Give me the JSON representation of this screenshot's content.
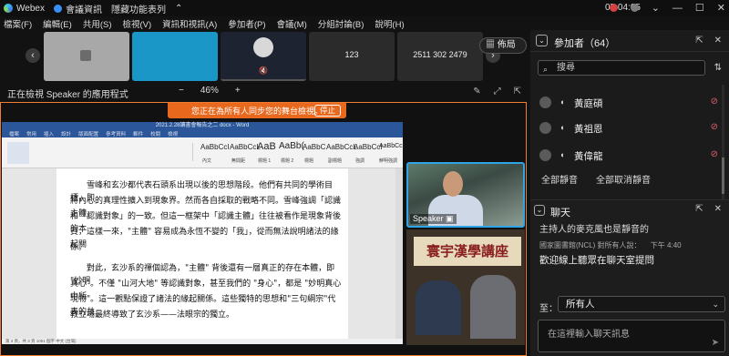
{
  "titlebar": {
    "app": "Webex",
    "meeting_info": "會議資訊",
    "hidden_list": "隱藏功能表列",
    "clock": "05:04:05"
  },
  "menu": [
    "檔案(F)",
    "編輯(E)",
    "共用(S)",
    "檢視(V)",
    "資訊和視訊(A)",
    "參加者(P)",
    "會議(M)",
    "分組討論(B)",
    "說明(H)"
  ],
  "strip": {
    "tile_a_label": "123",
    "tile_b_label": "2511 302 2479",
    "layout_button": "佈局"
  },
  "viewbar": {
    "viewing_text": "正在檢視 Speaker 的應用程式",
    "zoom_minus": "−",
    "zoom_value": "46%",
    "zoom_plus": "+"
  },
  "share": {
    "banner_text": "您正在為所有人同步您的舞台檢視。",
    "stop_label": "停止",
    "word_title": "2021.2.28讀書會報告之二 docx - Word",
    "word_tabs": [
      "檔案",
      "常用",
      "插入",
      "設計",
      "版面配置",
      "參考資料",
      "郵件",
      "校閱",
      "檢視"
    ],
    "styles": [
      {
        "sample": "AaBbCcI",
        "name": "內文"
      },
      {
        "sample": "AaBbCcL",
        "name": "無間距"
      },
      {
        "sample": "AaB",
        "name": "標題 1"
      },
      {
        "sample": "AaBb(",
        "name": "標題 2"
      },
      {
        "sample": "AaBbC",
        "name": "標題"
      },
      {
        "sample": "AaBbCcL",
        "name": "副標題"
      },
      {
        "sample": "AaBbCcI",
        "name": "強調"
      },
      {
        "sample": "AaBbCcI",
        "name": "鮮明強調"
      }
    ],
    "doc_paragraphs": [
      "雪峰和玄沙都代表石頭系出現以後的思想階段。他們有共同的學術目標，即",
      "將內心的真理性擴入到現象界。然而各自採取的戰略不同。雪峰強調「認識主體」",
      "和「認識對象」的一致。但這一框架中「認識主體」往往被看作是現象背後的本",
      "質，這樣一來，\"主體\" 容易成為永恆不變的「我」，從而無法說明諸法的緣起關",
      "係。",
      "對此，玄沙系的禪個認為，\"主體\" 背後還有一層真正的存在本體，即 \"妙明",
      "真心\"。不僅 \"山河大地\" 等認識對象，甚至我們的 \"身心\"，都是 \"妙明真心中所",
      "現物\"。這一觀點保證了諸法的緣起關係。這些獨特的思想和\"三句綱宗\"代表的共",
      "教立場最終導致了玄沙系——法眼宗的獨立。"
    ],
    "word_status": "第 3 頁，共 3 頁   1051 個字   中文 (台灣)",
    "speaker_label": "Speaker",
    "stage_banner": "寰宇漢學講座"
  },
  "participants": {
    "title": "參加者（64）",
    "search_placeholder": "搜尋",
    "names": [
      "黃庭碩",
      "黃祖恩",
      "黃偉龍"
    ],
    "mute_all": "全部靜音",
    "unmute_all": "全部取消靜音"
  },
  "chat": {
    "title": "聊天",
    "cut_message": "主持人的麥克風也是靜音的",
    "sender": "國家圖書館(NCL) 對所有人說：",
    "time": "下午 4:40",
    "message": "歡迎線上聽眾在聊天室提問",
    "to_label": "至：",
    "to_value": "所有人",
    "input_placeholder": "在這裡輸入聊天訊息"
  },
  "colors": {
    "accent_orange": "#e8681d",
    "speaker_border": "#2fa5e5",
    "word_blue": "#2b579a"
  }
}
